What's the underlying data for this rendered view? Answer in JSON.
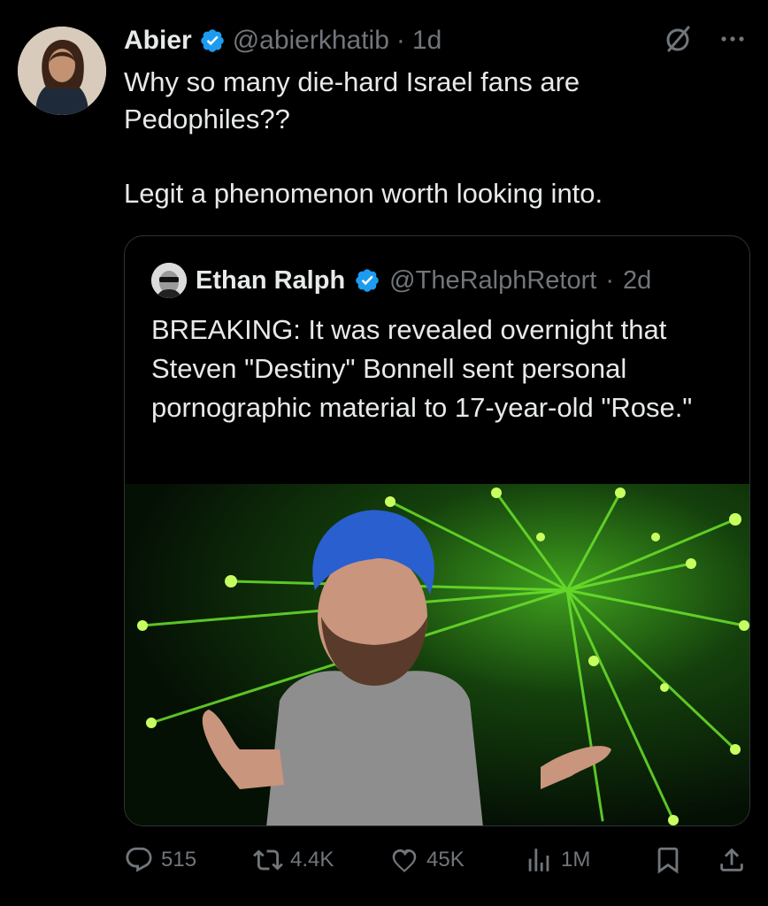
{
  "tweet": {
    "author_name": "Abier",
    "handle": "@abierkhatib",
    "separator": "·",
    "time": "1d",
    "text": "Why so many die-hard Israel fans are\nPedophiles??\n\nLegit a phenomenon worth looking into."
  },
  "quote": {
    "author_name": "Ethan Ralph",
    "handle": "@TheRalphRetort",
    "separator": "·",
    "time": "2d",
    "text": "BREAKING: It was revealed overnight that Steven \"Destiny\" Bonnell sent personal pornographic material to 17-year-old \"Rose.\""
  },
  "actions": {
    "replies": "515",
    "reposts": "4.4K",
    "likes": "45K",
    "views": "1M"
  },
  "icons": {
    "verified": "verified-badge-icon",
    "grok": "grok-icon",
    "more": "more-icon",
    "reply": "reply-icon",
    "repost": "repost-icon",
    "like": "heart-icon",
    "views": "views-icon",
    "bookmark": "bookmark-icon",
    "share": "share-icon"
  },
  "colors": {
    "background": "#000000",
    "text": "#e7e9ea",
    "secondary": "#71767b",
    "verified": "#1d9bf0",
    "border": "#2f3336"
  }
}
